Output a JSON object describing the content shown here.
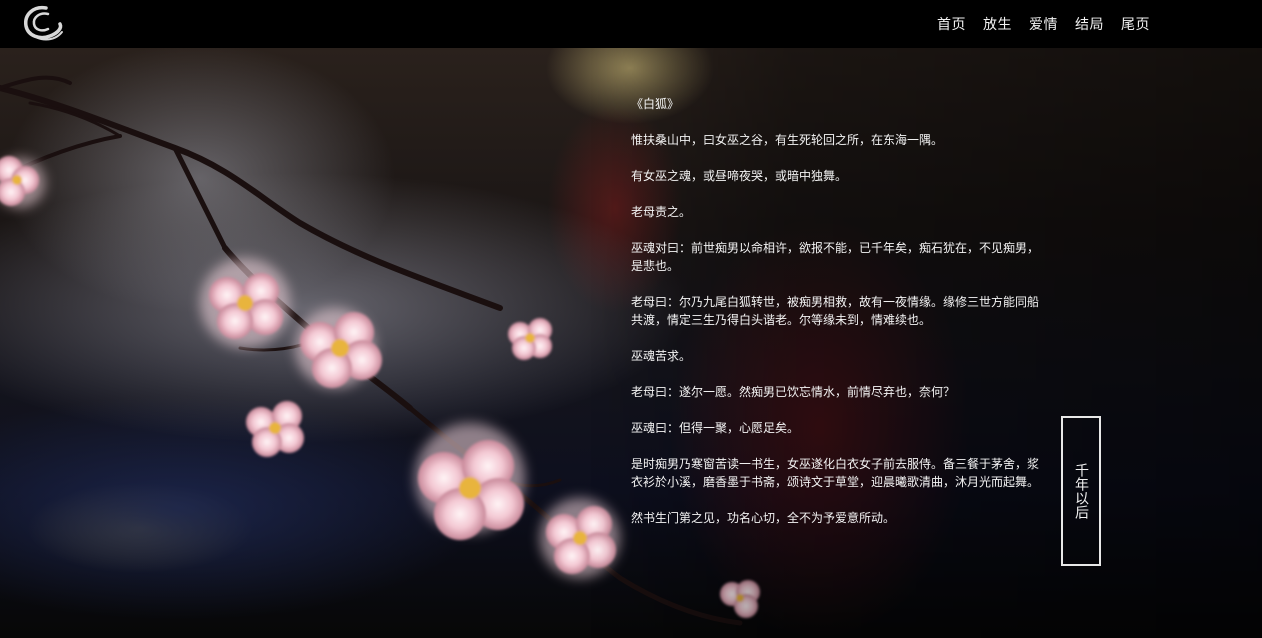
{
  "header": {
    "logo_icon": "swirl-logo-icon",
    "nav": [
      {
        "label": "首页"
      },
      {
        "label": "放生"
      },
      {
        "label": "爱情"
      },
      {
        "label": "结局"
      },
      {
        "label": "尾页"
      }
    ]
  },
  "article": {
    "title": "《白狐》",
    "paragraphs": [
      "惟扶桑山中，曰女巫之谷，有生死轮回之所，在东海一隅。",
      "有女巫之魂，或昼啼夜哭，或暗中独舞。",
      "老母责之。",
      "巫魂对曰：前世痴男以命相许，欲报不能，已千年矣，痴石犹在，不见痴男，是悲也。",
      "老母曰：尔乃九尾白狐转世，被痴男相救，故有一夜情缘。缘修三世方能同船共渡，情定三生乃得白头谐老。尔等缘未到，情难续也。",
      "巫魂苦求。",
      "老母曰：遂尔一愿。然痴男已饮忘情水，前情尽弃也，奈何？",
      "巫魂曰：但得一聚，心愿足矣。",
      "是时痴男乃寒窗苦读一书生，女巫遂化白衣女子前去服侍。备三餐于茅舍，浆衣衫於小溪，磨香墨于书斋，颂诗文于草堂，迎晨曦歌清曲，沐月光而起舞。",
      "然书生门第之见，功名心切，全不为予爱意所动。"
    ]
  },
  "side_button": {
    "label": "千年以后"
  },
  "colors": {
    "topbar": "#000000",
    "text": "#f4f4f4",
    "blossom": "#f2c6d2",
    "branch": "#1a1010"
  }
}
